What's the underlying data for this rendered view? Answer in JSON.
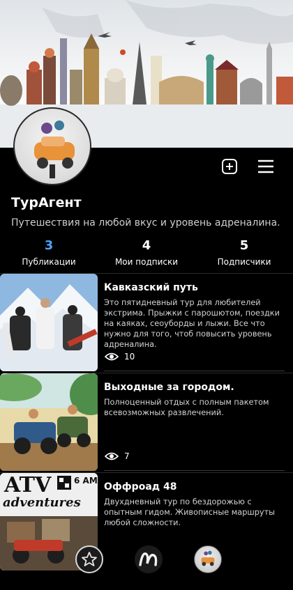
{
  "profile": {
    "name": "ТурАгент",
    "bio": "Путешествия на любой вкус и уровень адреналина."
  },
  "stats": [
    {
      "value": "3",
      "label": "Публикации"
    },
    {
      "value": "4",
      "label": "Мои подписки"
    },
    {
      "value": "5",
      "label": "Подписчики"
    }
  ],
  "posts": [
    {
      "title": "Кавказский путь",
      "text": "Это пятидневный тур для любителей экстрима. Прыжки с парошютом, поездки на каяках, сеоуборды и лыжи. Все что нужно для того, чтоб повысить уровень адреналина.",
      "views": "10"
    },
    {
      "title": "Выходные за городом.",
      "text": "Полноценный отдых с полным пакетом всевозможных развлечений.",
      "views": "7"
    },
    {
      "title": "Оффроад 48",
      "text": "Двухдневный тур по бездорожью с опытным гидом. Живописные маршруты любой сложности."
    }
  ],
  "thumb_texts": {
    "post3_brand": "ATV",
    "post3_script": "adventures",
    "post3_time": "6 AM"
  },
  "icons": {
    "add": "plus-square-icon",
    "menu": "hamburger-menu-icon",
    "views": "eye-icon",
    "nav_favorites": "star-icon",
    "nav_brand": "brand-logo-icon",
    "nav_profile": "profile-avatar-icon"
  },
  "colors": {
    "background": "#000000",
    "accent": "#4da3ff",
    "text_secondary": "#cfcfcf"
  }
}
